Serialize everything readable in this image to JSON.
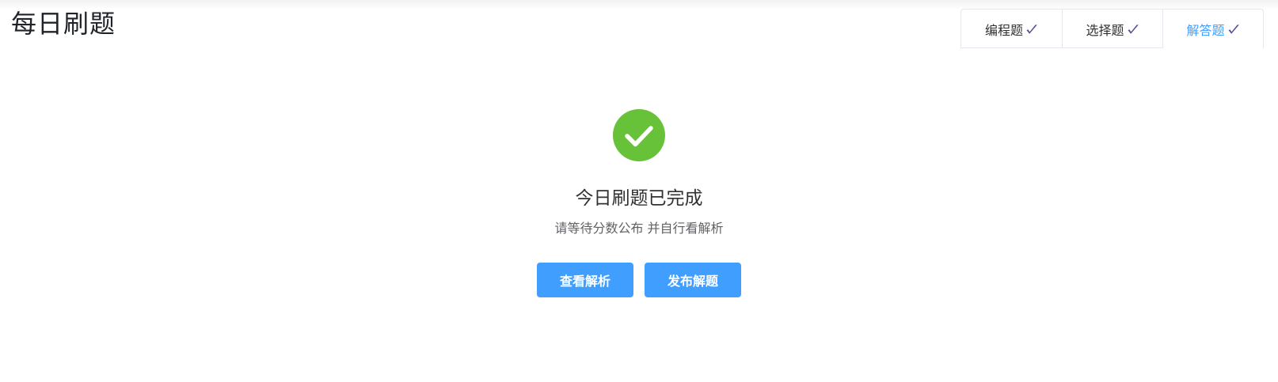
{
  "page_title": "每日刷题",
  "tabs": [
    {
      "label": "编程题",
      "check_icon": "check-icon",
      "active": false
    },
    {
      "label": "选择题",
      "check_icon": "check-icon",
      "active": false
    },
    {
      "label": "解答题",
      "check_icon": "check-icon",
      "active": true
    }
  ],
  "result": {
    "icon": "success-check-icon",
    "title": "今日刷题已完成",
    "subtitle": "请等待分数公布 并自行看解析"
  },
  "actions": {
    "view_analysis_label": "查看解析",
    "publish_solution_label": "发布解题"
  },
  "colors": {
    "primary": "#409eff",
    "success": "#67c23a",
    "check_mark": "#5b4f96",
    "text_primary": "#303133",
    "text_secondary": "#606266"
  }
}
